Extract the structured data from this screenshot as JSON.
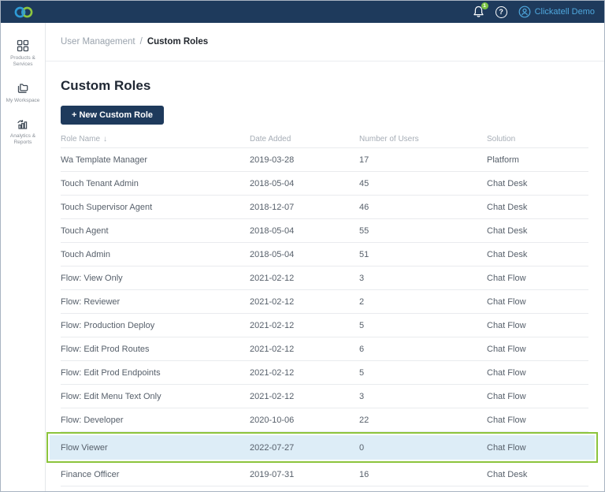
{
  "colors": {
    "navbar_navy": "#1e3a5c",
    "brand_blue": "#2e9bd6",
    "brand_green": "#8dc63f",
    "link_blue": "#4fa8de",
    "badge_green": "#7ac143",
    "highlight_border_green": "#8cc43c",
    "highlight_row_blue": "#ddedf7"
  },
  "topbar": {
    "notification_count": "1",
    "help_label": "?",
    "user_name": "Clickatell Demo"
  },
  "sidebar": {
    "items": [
      {
        "label": "Products & Services",
        "icon": "grid-icon"
      },
      {
        "label": "My Workspace",
        "icon": "folder-icon"
      },
      {
        "label": "Analytics & Reports",
        "icon": "bar-chart-icon"
      }
    ]
  },
  "breadcrumb": {
    "parent": "User Management",
    "separator": "/",
    "current": "Custom Roles"
  },
  "page": {
    "title": "Custom Roles",
    "new_role_button": "+ New Custom Role"
  },
  "table": {
    "columns": [
      "Role Name",
      "Date Added",
      "Number of Users",
      "Solution"
    ],
    "sort": {
      "column": "Role Name",
      "direction": "descending",
      "arrow": "↓"
    },
    "rows": [
      {
        "role": "Wa Template Manager",
        "date": "2019-03-28",
        "users": "17",
        "solution": "Platform",
        "highlighted": false
      },
      {
        "role": "Touch Tenant Admin",
        "date": "2018-05-04",
        "users": "45",
        "solution": "Chat Desk",
        "highlighted": false
      },
      {
        "role": "Touch Supervisor Agent",
        "date": "2018-12-07",
        "users": "46",
        "solution": "Chat Desk",
        "highlighted": false
      },
      {
        "role": "Touch Agent",
        "date": "2018-05-04",
        "users": "55",
        "solution": "Chat Desk",
        "highlighted": false
      },
      {
        "role": "Touch Admin",
        "date": "2018-05-04",
        "users": "51",
        "solution": "Chat Desk",
        "highlighted": false
      },
      {
        "role": "Flow: View Only",
        "date": "2021-02-12",
        "users": "3",
        "solution": "Chat Flow",
        "highlighted": false
      },
      {
        "role": "Flow: Reviewer",
        "date": "2021-02-12",
        "users": "2",
        "solution": "Chat Flow",
        "highlighted": false
      },
      {
        "role": "Flow: Production Deploy",
        "date": "2021-02-12",
        "users": "5",
        "solution": "Chat Flow",
        "highlighted": false
      },
      {
        "role": "Flow: Edit Prod Routes",
        "date": "2021-02-12",
        "users": "6",
        "solution": "Chat Flow",
        "highlighted": false
      },
      {
        "role": "Flow: Edit Prod Endpoints",
        "date": "2021-02-12",
        "users": "5",
        "solution": "Chat Flow",
        "highlighted": false
      },
      {
        "role": "Flow: Edit Menu Text Only",
        "date": "2021-02-12",
        "users": "3",
        "solution": "Chat Flow",
        "highlighted": false
      },
      {
        "role": "Flow: Developer",
        "date": "2020-10-06",
        "users": "22",
        "solution": "Chat Flow",
        "highlighted": false
      },
      {
        "role": "Flow Viewer",
        "date": "2022-07-27",
        "users": "0",
        "solution": "Chat Flow",
        "highlighted": true
      },
      {
        "role": "Finance Officer",
        "date": "2019-07-31",
        "users": "16",
        "solution": "Chat Desk",
        "highlighted": false
      }
    ]
  }
}
